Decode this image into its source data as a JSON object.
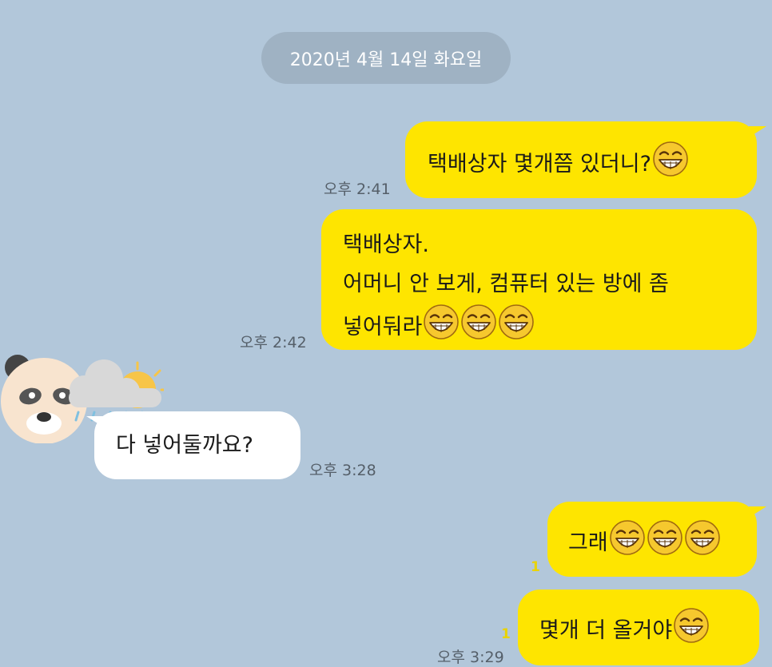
{
  "chat": {
    "date_label": "2020년 4월 14일 화요일",
    "messages": [
      {
        "sender": "me",
        "lines": [
          "택배상자 몇개쯤 있더니?"
        ],
        "emoji": [
          "grin-squint-icon"
        ],
        "time": "오후 2:41"
      },
      {
        "sender": "me",
        "lines": [
          "택배상자.",
          "어머니 안 보게, 컴퓨터 있는 방에 좀",
          "넣어둬라"
        ],
        "emoji": [
          "grin-squint-icon",
          "grin-squint-icon",
          "grin-squint-icon"
        ],
        "time": "오후 2:42"
      },
      {
        "sender": "other",
        "lines": [
          "다 넣어둘까요?"
        ],
        "time": "오후 3:28"
      },
      {
        "sender": "me",
        "lines": [
          "그래"
        ],
        "emoji": [
          "grin-squint-icon",
          "grin-squint-icon",
          "grin-squint-icon"
        ],
        "unread": "1"
      },
      {
        "sender": "me",
        "lines": [
          "몇개 더 올거야"
        ],
        "emoji": [
          "grin-squint-icon"
        ],
        "unread": "1",
        "time": "오후 3:29"
      }
    ]
  },
  "colors": {
    "background": "#b2c7da",
    "my_bubble": "#fee500",
    "other_bubble": "#ffffff",
    "date_pill": "#9fb2c3",
    "unread_count": "#e9d300"
  }
}
